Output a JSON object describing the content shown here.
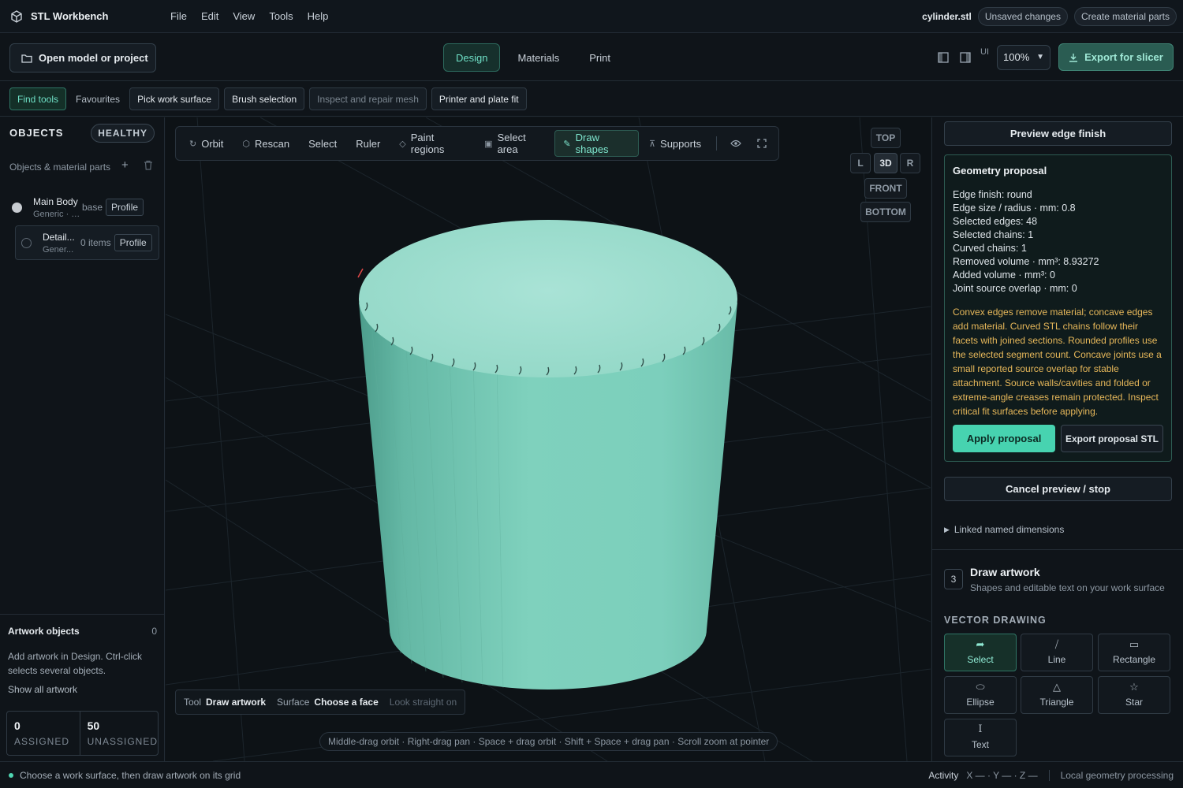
{
  "app": {
    "name": "STL Workbench",
    "menu": [
      "File",
      "Edit",
      "View",
      "Tools",
      "Help"
    ],
    "file_name": "cylinder.stl",
    "unsaved": "Unsaved changes",
    "create_parts": "Create material parts"
  },
  "toolbar": {
    "open": "Open model or project",
    "modes": [
      "Design",
      "Materials",
      "Print"
    ],
    "active_mode": "Design",
    "ui_label": "UI",
    "zoom": "100%",
    "export": "Export for slicer"
  },
  "quickbar": {
    "find_tools": "Find tools",
    "favourites": "Favourites",
    "pick_surface": "Pick work surface",
    "brush": "Brush selection",
    "inspect": "Inspect and repair mesh",
    "printer_fit": "Printer and plate fit"
  },
  "objects": {
    "heading": "OBJECTS",
    "health": "HEALTHY",
    "subheading": "Objects & material parts",
    "items": [
      {
        "name": "Main Body",
        "meta": "Generic · P...",
        "tag": "base",
        "action": "Profile"
      },
      {
        "name": "Detail...",
        "meta": "Gener...",
        "tag": "0 items",
        "action": "Profile"
      }
    ]
  },
  "artwork": {
    "title": "Artwork objects",
    "count": "0",
    "description": "Add artwork in Design. Ctrl-click selects several objects.",
    "show_all": "Show all artwork",
    "assigned_num": "0",
    "assigned_label": "ASSIGNED",
    "unassigned_num": "50",
    "unassigned_label": "UNASSIGNED"
  },
  "viewport": {
    "tools": [
      "Orbit",
      "Rescan",
      "Select",
      "Ruler",
      "Paint regions",
      "Select area",
      "Draw shapes",
      "Supports"
    ],
    "active_tool": "Draw shapes",
    "views": {
      "top": "TOP",
      "left": "L",
      "3d": "3D",
      "right": "R",
      "front": "FRONT",
      "bottom": "BOTTOM"
    },
    "status": {
      "tool_label": "Tool",
      "tool_value": "Draw artwork",
      "surface_label": "Surface",
      "surface_value": "Choose a face",
      "look": "Look straight on"
    },
    "hint": "Middle-drag orbit · Right-drag pan · Space + drag orbit · Shift + Space + drag pan · Scroll zoom at pointer",
    "model_color": "#7ccfbc"
  },
  "right_panel": {
    "preview_btn": "Preview edge finish",
    "proposal": {
      "title": "Geometry proposal",
      "lines": [
        "Edge finish: round",
        "Edge size / radius · mm: 0.8",
        "Selected edges: 48",
        "Selected chains: 1",
        "Curved chains: 1",
        "Removed volume · mm³: 8.93272",
        "Added volume · mm³: 0",
        "Joint source overlap · mm: 0"
      ],
      "warning": "Convex edges remove material; concave edges add material. Curved STL chains follow their facets with joined sections. Rounded profiles use the selected segment count. Concave joints use a small reported source overlap for stable attachment. Source walls/cavities and folded or extreme-angle creases remain protected. Inspect critical fit surfaces before applying.",
      "apply": "Apply proposal",
      "export": "Export proposal STL"
    },
    "cancel": "Cancel preview / stop",
    "linked": "Linked named dimensions",
    "step": {
      "number": "3",
      "title": "Draw artwork",
      "subtitle": "Shapes and editable text on your work surface"
    },
    "vector_heading": "VECTOR DRAWING",
    "shapes": [
      "Select",
      "Line",
      "Rectangle",
      "Ellipse",
      "Triangle",
      "Star",
      "Text"
    ],
    "active_shape": "Select"
  },
  "footer": {
    "status": "Choose a work surface, then draw artwork on its grid",
    "activity": "Activity",
    "coords": "X — · Y — · Z —",
    "processing": "Local geometry processing"
  }
}
